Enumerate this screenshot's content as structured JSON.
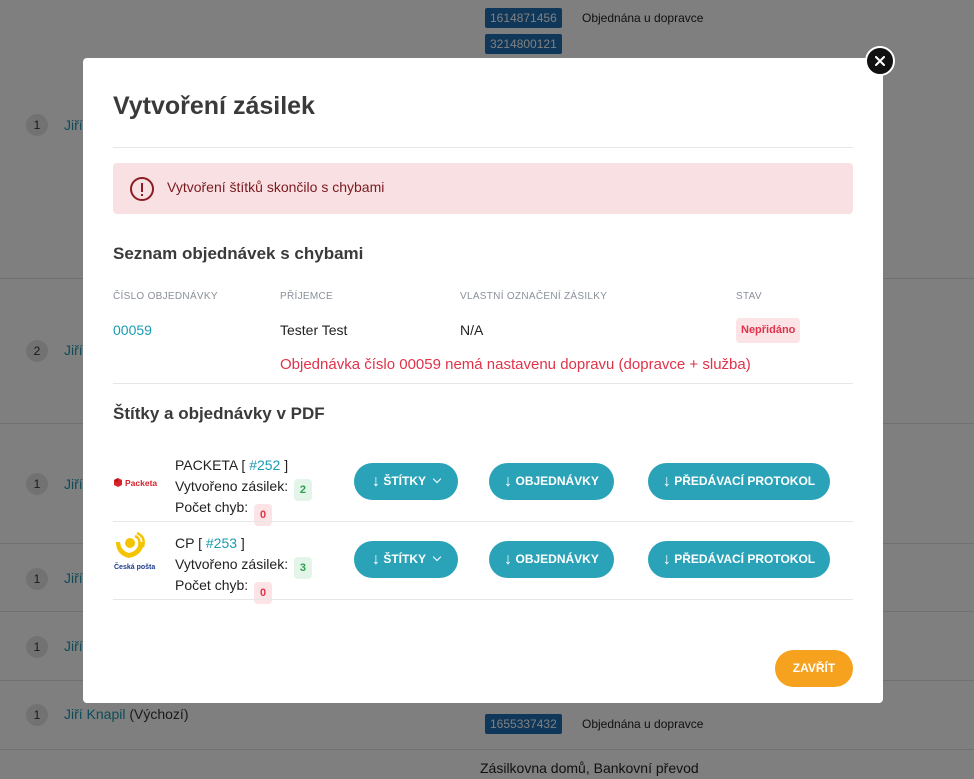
{
  "background": {
    "rows": [
      {
        "num": "1",
        "name": "Jiří"
      },
      {
        "num": "2",
        "name": "Jiří"
      },
      {
        "num": "1",
        "name": "Jiří"
      },
      {
        "num": "1",
        "name": "Jiří"
      },
      {
        "num": "1",
        "name": "Jiří"
      },
      {
        "num": "1",
        "name": "Jiří Knapil",
        "suffix": "(Výchozí)"
      }
    ],
    "tags": [
      {
        "id": "1614871456",
        "status": "Objednána u dopravce"
      },
      {
        "id": "3214800121",
        "status": ""
      },
      {
        "id": "1655337432",
        "status": "Objednána u dopravce"
      }
    ],
    "bottom_text": "Zásilkovna domů, Bankovní převod"
  },
  "modal": {
    "title": "Vytvoření zásilek",
    "alert_text": "Vytvoření štítků skončilo s chybami",
    "errors_section_title": "Seznam objednávek s chybami",
    "table": {
      "headers": [
        "Číslo objednávky",
        "Příjemce",
        "Vlastní označení zásilky",
        "Stav"
      ],
      "row": {
        "order": "00059",
        "recipient": "Tester Test",
        "custom_label": "N/A",
        "status": "Nepřidáno"
      },
      "error_message": "Objednávka číslo 00059 nemá nastavenu dopravu (dopravce + služba)"
    },
    "pdf_section_title": "Štítky a objednávky v PDF",
    "carriers": [
      {
        "name": "PACKETA",
        "batch": "#252",
        "created_label": "Vytvořeno zásilek:",
        "created_count": "2",
        "errors_label": "Počet chyb:",
        "errors_count": "0",
        "logo_text": "Packeta",
        "logo_icon": "packeta-logo"
      },
      {
        "name": "CP",
        "batch": "#253",
        "created_label": "Vytvořeno zásilek:",
        "created_count": "3",
        "errors_label": "Počet chyb:",
        "errors_count": "0",
        "logo_text": "Česká pošta",
        "logo_icon": "ceska-posta-logo"
      }
    ],
    "buttons": {
      "labels": "ŠTÍTKY",
      "orders": "OBJEDNÁVKY",
      "protocol": "PŘEDÁVACÍ PROTOKOL",
      "arrow": "↓",
      "close": "ZAVŘÍT"
    },
    "colors": {
      "accent": "#2aa3b8",
      "close_button": "#f6a21e",
      "error": "#e0334a",
      "alert_bg": "#f9e1e3"
    }
  }
}
